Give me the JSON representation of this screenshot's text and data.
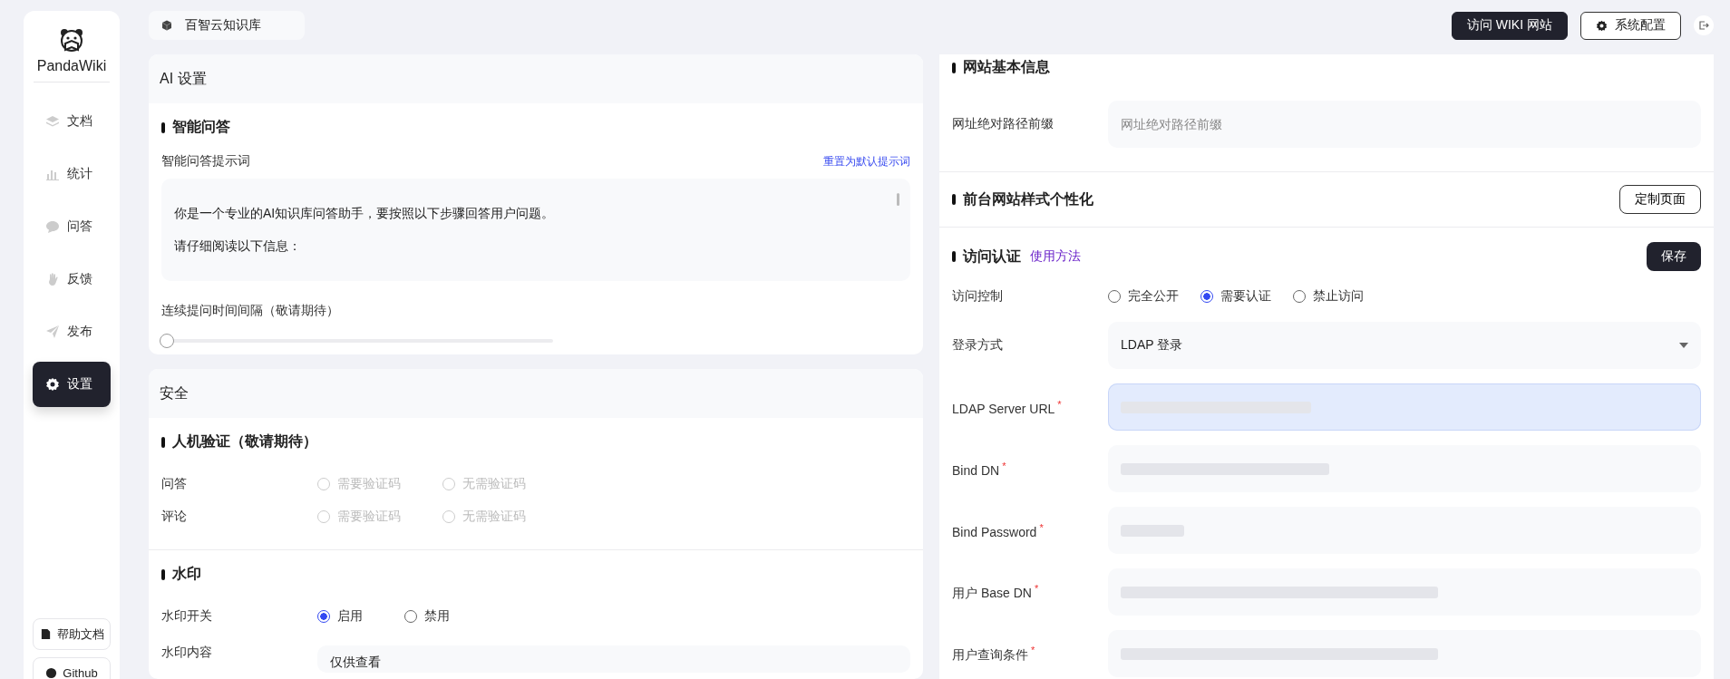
{
  "sidebar": {
    "logo": "PandaWiki",
    "items": [
      {
        "label": "文档",
        "selected": false
      },
      {
        "label": "统计",
        "selected": false
      },
      {
        "label": "问答",
        "selected": false
      },
      {
        "label": "反馈",
        "selected": false
      },
      {
        "label": "发布",
        "selected": false
      },
      {
        "label": "设置",
        "selected": true
      }
    ],
    "bottom_links": [
      {
        "label": "帮助文档"
      },
      {
        "label": "Github"
      }
    ]
  },
  "header": {
    "breadcrumb": "百智云知识库",
    "buttons": [
      {
        "label": "访问 WIKI 网站",
        "kind": "primary"
      },
      {
        "label": "系统配置",
        "kind": "outline"
      }
    ]
  },
  "ai_settings": {
    "title": "AI 设置",
    "section": "智能问答",
    "prompt_label": "智能问答提示词",
    "reset_link": "重置为默认提示词",
    "prompt_lines": [
      "你是一个专业的AI知识库问答助手，要按照以下步骤回答用户问题。",
      "请仔细阅读以下信息："
    ],
    "interval": {
      "label": "连续提问时间间隔（敬请期待）",
      "level": 0
    }
  },
  "security": {
    "title": "安全",
    "sections": [
      {
        "title": "人机验证（敬请期待）",
        "rows": [
          {
            "kind": "radio",
            "label": "问答",
            "disabled": true,
            "options": [
              {
                "label": "需要验证码",
                "selected": false
              },
              {
                "label": "无需验证码",
                "selected": false
              }
            ]
          },
          {
            "kind": "radio",
            "label": "评论",
            "disabled": true,
            "options": [
              {
                "label": "需要验证码",
                "selected": false
              },
              {
                "label": "无需验证码",
                "selected": false
              }
            ]
          }
        ]
      },
      {
        "title": "水印",
        "rows": [
          {
            "kind": "radio",
            "label": "水印开关",
            "disabled": false,
            "options": [
              {
                "label": "启用",
                "selected": true
              },
              {
                "label": "禁用",
                "selected": false
              }
            ]
          },
          {
            "kind": "text",
            "label": "水印内容",
            "value": "仅供查看"
          }
        ]
      }
    ]
  },
  "site_info": {
    "title": "网站基本信息",
    "fields": [
      {
        "label": "网址绝对路径前缀",
        "placeholder": "网址绝对路径前缀"
      }
    ]
  },
  "site_style": {
    "title": "前台网站样式个性化",
    "button": "定制页面"
  },
  "access_auth": {
    "title": "访问认证",
    "help_link": "使用方法",
    "save": "保存",
    "access": {
      "label": "访问控制",
      "options": [
        {
          "label": "完全公开",
          "selected": false
        },
        {
          "label": "需要认证",
          "selected": true
        },
        {
          "label": "禁止访问",
          "selected": false
        }
      ]
    },
    "login": {
      "label": "登录方式",
      "value": "LDAP 登录"
    },
    "fields": [
      {
        "label": "LDAP Server URL",
        "required_mark": "*",
        "focused": true
      },
      {
        "label": "Bind DN",
        "required_mark": "*",
        "focused": false
      },
      {
        "label": "Bind Password",
        "required_mark": "*",
        "focused": false
      },
      {
        "label": "用户 Base DN",
        "required_mark": "*",
        "focused": false
      },
      {
        "label": "用户查询条件",
        "required_mark": "*",
        "focused": false
      }
    ]
  }
}
